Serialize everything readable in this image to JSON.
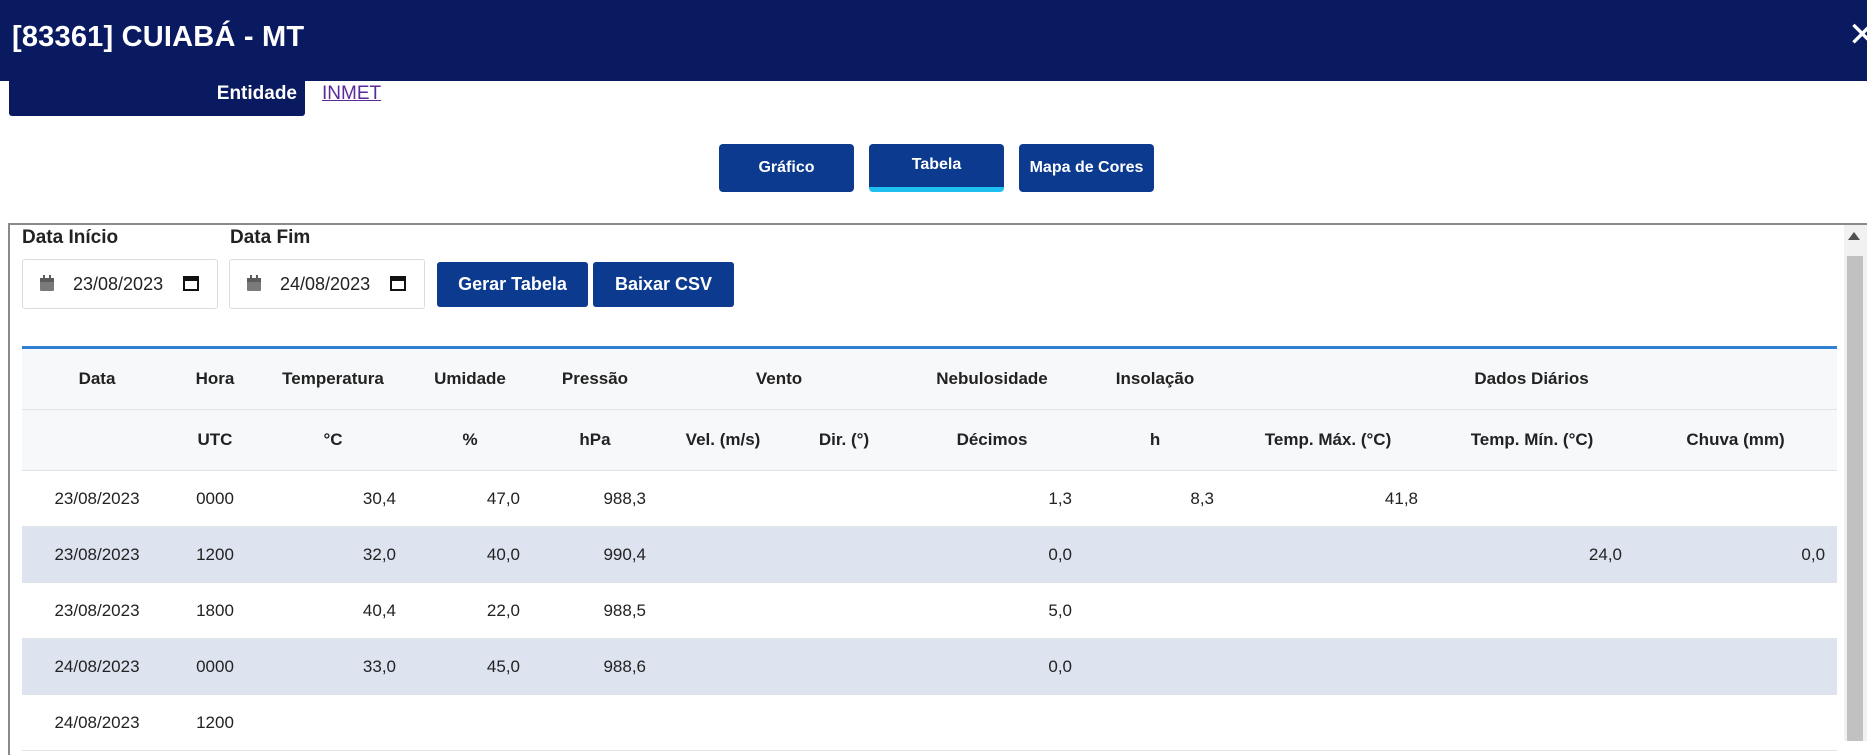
{
  "window": {
    "title": "[83361] CUIABÁ - MT",
    "close_icon": "close-icon"
  },
  "entity": {
    "label": "Entidade",
    "link": "INMET"
  },
  "tabs": [
    {
      "label": "Gráfico",
      "active": false
    },
    {
      "label": "Tabela",
      "active": true
    },
    {
      "label": "Mapa de Cores",
      "active": false
    }
  ],
  "filters": {
    "start_label": "Data Início",
    "start_value": "23/08/2023",
    "end_label": "Data Fim",
    "end_value": "24/08/2023",
    "generate_button": "Gerar Tabela",
    "csv_button": "Baixar CSV"
  },
  "table": {
    "header_top": [
      "Data",
      "Hora",
      "Temperatura",
      "Umidade",
      "Pressão",
      "Vento",
      "Nebulosidade",
      "Insolação",
      "Dados Diários"
    ],
    "header_units": [
      "",
      "UTC",
      "°C",
      "%",
      "hPa",
      "Vel. (m/s)",
      "Dir. (°)",
      "Décimos",
      "h",
      "Temp. Máx. (°C)",
      "Temp. Mín. (°C)",
      "Chuva (mm)"
    ],
    "rows": [
      [
        "23/08/2023",
        "0000",
        "30,4",
        "47,0",
        "988,3",
        "",
        "",
        "1,3",
        "8,3",
        "41,8",
        "",
        ""
      ],
      [
        "23/08/2023",
        "1200",
        "32,0",
        "40,0",
        "990,4",
        "",
        "",
        "0,0",
        "",
        "",
        "24,0",
        "0,0"
      ],
      [
        "23/08/2023",
        "1800",
        "40,4",
        "22,0",
        "988,5",
        "",
        "",
        "5,0",
        "",
        "",
        "",
        ""
      ],
      [
        "24/08/2023",
        "0000",
        "33,0",
        "45,0",
        "988,6",
        "",
        "",
        "0,0",
        "",
        "",
        "",
        ""
      ],
      [
        "24/08/2023",
        "1200",
        "",
        "",
        "",
        "",
        "",
        "",
        "",
        "",
        "",
        ""
      ]
    ]
  },
  "colors": {
    "header_bg": "#0a1a60",
    "button_bg": "#0b3a8e",
    "tab_active_underline": "#1ec0f0",
    "row_alt": "#dde3ef"
  }
}
